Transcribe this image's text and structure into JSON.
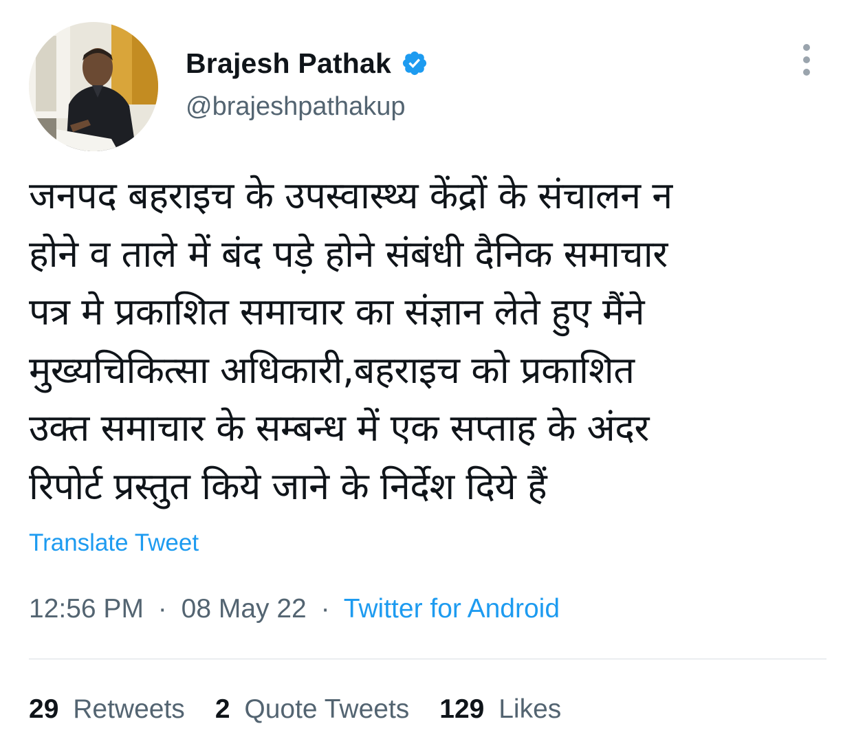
{
  "author": {
    "name": "Brajesh Pathak",
    "handle": "@brajeshpathakup",
    "verified": true
  },
  "tweet": {
    "text_lines": [
      "जनपद बहराइच के उपस्वास्थ्य केंद्रों के संचालन न",
      "होने व ताले में बंद पड़े होने संबंधी दैनिक समाचार",
      "पत्र मे प्रकाशित समाचार का संज्ञान लेते हुए मैंने",
      "मुख्यचिकित्सा अधिकारी,बहराइच को प्रकाशित",
      "उक्त समाचार के सम्बन्ध में एक सप्ताह के अंदर",
      "रिपोर्ट प्रस्तुत किये जाने के निर्देश दिये हैं"
    ],
    "translate_label": "Translate Tweet",
    "time": "12:56 PM",
    "separator": "·",
    "date": "08 May 22",
    "source": "Twitter for Android"
  },
  "stats": {
    "retweets_count": "29",
    "retweets_label": "Retweets",
    "quotes_count": "2",
    "quotes_label": "Quote Tweets",
    "likes_count": "129",
    "likes_label": "Likes"
  },
  "colors": {
    "link": "#1d9bf0",
    "secondary_text": "#536471",
    "primary_text": "#0f1419",
    "verified_badge": "#1d9bf0"
  },
  "icons": {
    "verified": "verified-badge-icon",
    "more": "more-vertical-icon"
  }
}
